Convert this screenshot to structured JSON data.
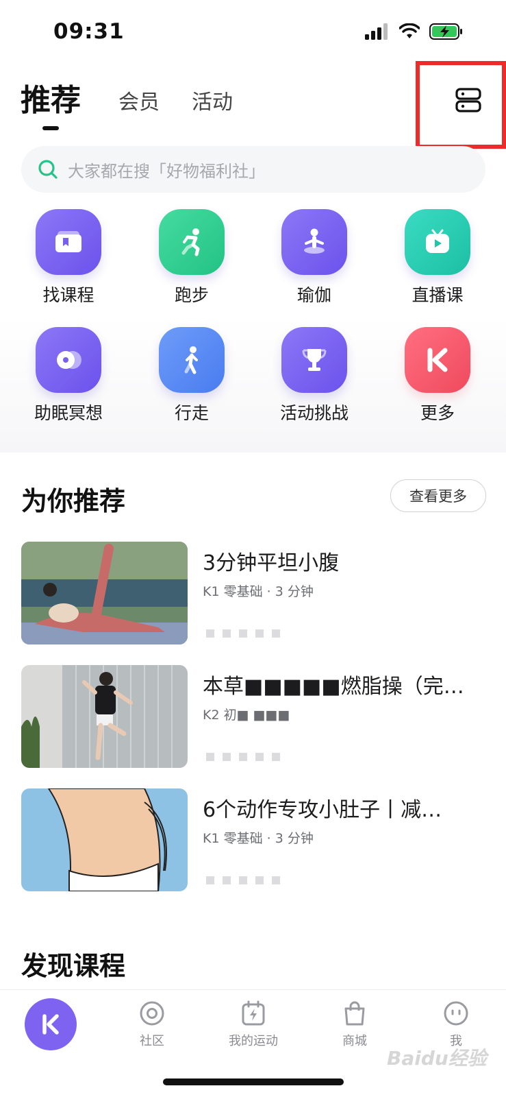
{
  "status_bar": {
    "time": "09:31"
  },
  "top_tabs": {
    "active": "推荐",
    "tab1": "会员",
    "tab2": "活动"
  },
  "search": {
    "placeholder": "大家都在搜「好物福利社」"
  },
  "quick_grid": [
    {
      "label": "找课程",
      "icon": "course-card-icon",
      "color": "#7b63f2"
    },
    {
      "label": "跑步",
      "icon": "running-icon",
      "color": "#2fcf8f"
    },
    {
      "label": "瑜伽",
      "icon": "yoga-icon",
      "color": "#7b63f2"
    },
    {
      "label": "直播课",
      "icon": "live-tv-icon",
      "color": "#27cdb3"
    },
    {
      "label": "助眠冥想",
      "icon": "meditation-icon",
      "color": "#7b63f2"
    },
    {
      "label": "行走",
      "icon": "walking-icon",
      "color": "#5a8bf5"
    },
    {
      "label": "活动挑战",
      "icon": "trophy-icon",
      "color": "#7b63f2"
    },
    {
      "label": "更多",
      "icon": "keep-logo-icon",
      "color": "#f5596a"
    }
  ],
  "recommend": {
    "title": "为你推荐",
    "more": "查看更多",
    "courses": [
      {
        "title": "3分钟平坦小腹",
        "meta": "K1 零基础 · 3 分钟"
      },
      {
        "title": "本草■■■■■燃脂操（完…",
        "meta": "K2 初■ ■■■"
      },
      {
        "title": "6个动作专攻小肚子丨减…",
        "meta": "K1 零基础 · 3 分钟"
      }
    ]
  },
  "discover": {
    "title": "发现课程"
  },
  "bottom_nav": [
    {
      "label": "社区"
    },
    {
      "label": "我的运动"
    },
    {
      "label": "商城"
    },
    {
      "label": "我"
    }
  ],
  "watermark": "Baidu经验",
  "colors": {
    "accent": "#7d63f0",
    "highlight": "#ee2b2b"
  }
}
